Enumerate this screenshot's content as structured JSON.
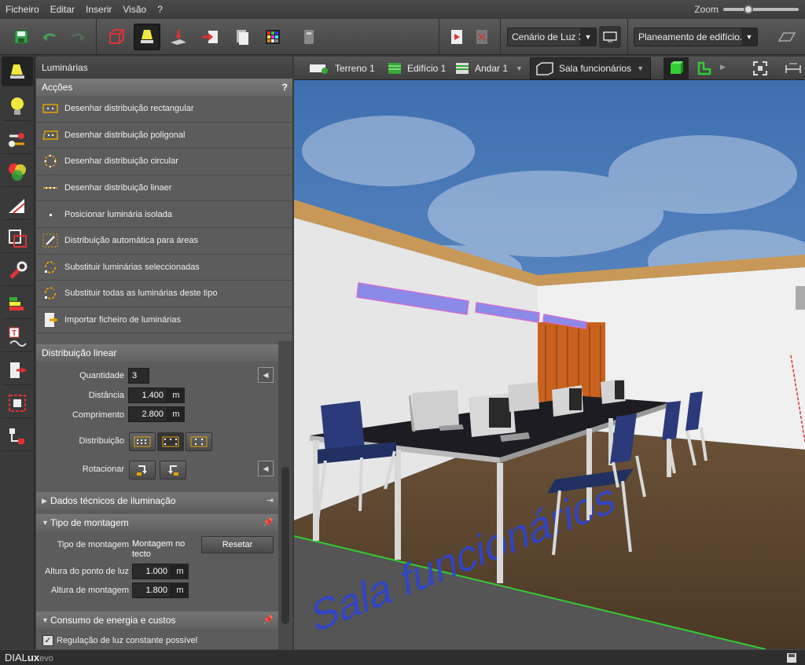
{
  "menu": {
    "items": [
      "Ficheiro",
      "Editar",
      "Inserir",
      "Visão",
      "?"
    ],
    "zoom_label": "Zoom"
  },
  "toolbar": {
    "light_scene": "Cenário de Luz 3",
    "planning": "Planeamento de edifício..."
  },
  "panel": {
    "title": "Luminárias",
    "actions_header": "Acções",
    "help_symbol": "?",
    "actions": [
      "Desenhar distribuição rectangular",
      "Desenhar distribuição poligonal",
      "Desenhar distribuição circular",
      "Desenhar distribuição linaer",
      "Posicionar luminária isolada",
      "Distribuição automática para áreas",
      "Substituir luminárias seleccionadas",
      "Substituir todas as luminárias deste tipo",
      "Importar ficheiro de luminárias"
    ],
    "linear": {
      "header": "Distribuição linear",
      "quantity_label": "Quantidade",
      "quantity": "3",
      "distance_label": "Distância",
      "distance": "1.400",
      "distance_unit": "m",
      "length_label": "Comprimento",
      "length": "2.800",
      "length_unit": "m",
      "distribution_label": "Distribuição",
      "rotate_label": "Rotacionar"
    },
    "tech_header": "Dados técnicos de iluminação",
    "mount": {
      "header": "Tipo de montagem",
      "type_label": "Tipo de montagem",
      "type_value": "Montagem no tecto",
      "reset": "Resetar",
      "point_label": "Altura do ponto de luz",
      "point_value": "1.000",
      "point_unit": "m",
      "mount_label": "Altura de montagem",
      "mount_value": "1.800",
      "mount_unit": "m"
    },
    "energy_header": "Consumo de energia e custos",
    "constant_light": "Regulação de luz constante possível"
  },
  "view": {
    "terrain": "Terreno 1",
    "building": "Edifício 1",
    "floor": "Andar 1",
    "room": "Sala funcionários",
    "floor_text": "Sala funcionários"
  },
  "status": {
    "brand_a": "DIAL",
    "brand_b": "ux",
    "brand_c": "evo"
  },
  "colors": {
    "accent": "#e8a000",
    "sky": "#4a78b8",
    "wall_wood": "#c89858",
    "floor": "#4a3a2a"
  }
}
